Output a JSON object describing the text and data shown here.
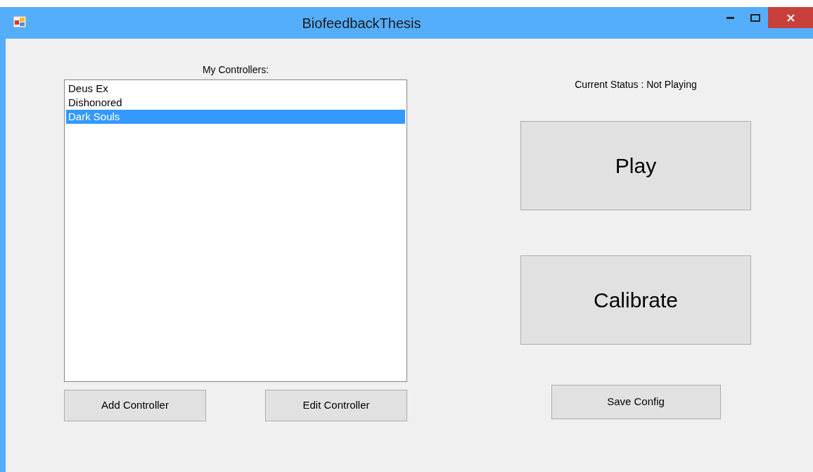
{
  "window": {
    "title": "BiofeedbackThesis"
  },
  "controllers_label": "My Controllers:",
  "controllers": [
    {
      "label": "Deus Ex",
      "selected": false
    },
    {
      "label": "Dishonored",
      "selected": false
    },
    {
      "label": "Dark Souls",
      "selected": true
    }
  ],
  "left_buttons": [
    "Add Controller",
    "Edit Controller"
  ],
  "status": "Current Status : Not Playing",
  "play_button": "Play",
  "calibrate_button": "Calibrate",
  "save_button": "Save Config"
}
